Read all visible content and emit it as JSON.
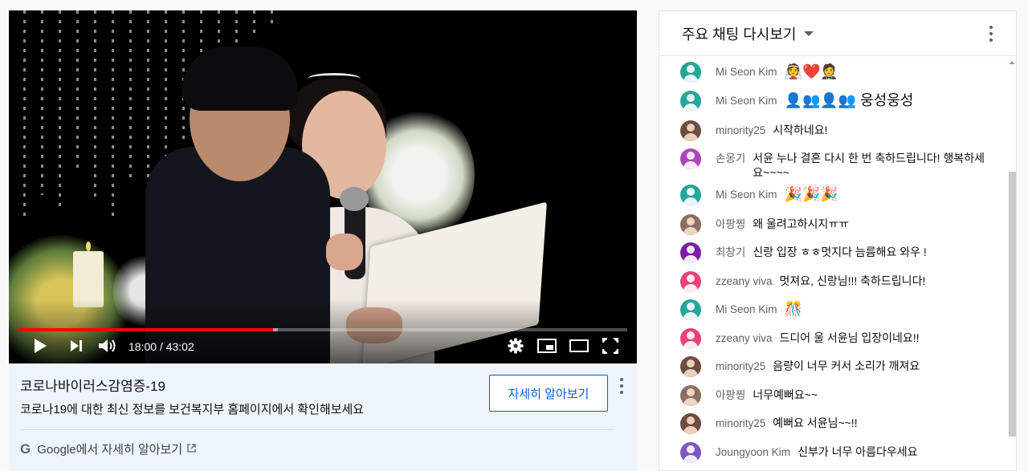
{
  "player": {
    "time_display": "18:00 / 43:02",
    "progress_played": 0.418,
    "progress_buffered": 0.426
  },
  "info": {
    "title": "코로나바이러스감염증-19",
    "description": "코로나19에 대한 최신 정보를 보건복지부 홈페이지에서 확인해보세요",
    "learn_more_label": "자세히 알아보기",
    "google_label": "Google에서 자세히 알아보기",
    "google_icon": "G"
  },
  "chat": {
    "title": "주요 채팅 다시보기",
    "messages": [
      {
        "author": "Mi Seon Kim",
        "text": "👰❤️🤵",
        "avatar_color": "#26a69a",
        "photo": false
      },
      {
        "author": "Mi Seon Kim",
        "text": "👤👥👤👥 웅성웅성",
        "avatar_color": "#26a69a",
        "photo": false
      },
      {
        "author": "minority25",
        "text": "시작하네요!",
        "avatar_color": "#6d4c41",
        "photo": true
      },
      {
        "author": "손옹기",
        "text": "서윤 누나 결혼 다시 한 번 축하드립니다! 행복하세요~~~~",
        "avatar_color": "#ab47bc",
        "photo": false
      },
      {
        "author": "Mi Seon Kim",
        "text": "🎉🎉🎉",
        "avatar_color": "#26a69a",
        "photo": false
      },
      {
        "author": "아팡찡",
        "text": "왜 울려고하시지ㅠㅠ",
        "avatar_color": "#8d6e63",
        "photo": true
      },
      {
        "author": "최창기",
        "text": "신랑 입장 ㅎㅎ멋지다 늠름해요 와우 !",
        "avatar_color": "#7b1fa2",
        "photo": false
      },
      {
        "author": "zzeany viva",
        "text": "멋져요, 신랑님!!! 축하드립니다!",
        "avatar_color": "#ec407a",
        "photo": false
      },
      {
        "author": "Mi Seon Kim",
        "text": "🎊",
        "avatar_color": "#26a69a",
        "photo": false
      },
      {
        "author": "zzeany viva",
        "text": "드디어 울 서윤님 입장이네요!!",
        "avatar_color": "#ec407a",
        "photo": false
      },
      {
        "author": "minority25",
        "text": "음량이 너무 커서 소리가 깨져요",
        "avatar_color": "#6d4c41",
        "photo": true
      },
      {
        "author": "아팡찡",
        "text": "너무예뻐요~~",
        "avatar_color": "#8d6e63",
        "photo": true
      },
      {
        "author": "minority25",
        "text": "예뻐요 서윤님~~!!",
        "avatar_color": "#6d4c41",
        "photo": true
      },
      {
        "author": "Joungyoon Kim",
        "text": "신부가 너무 아름다우세요",
        "avatar_color": "#7e57c2",
        "photo": false
      }
    ]
  },
  "icons": {
    "play": "play-icon",
    "next": "next-icon",
    "volume": "volume-icon",
    "settings": "settings-icon",
    "miniplayer": "miniplayer-icon",
    "theater": "theater-icon",
    "fullscreen": "fullscreen-icon"
  },
  "colors": {
    "progress": "#ff0000",
    "link_blue": "#065fd4",
    "info_bg": "#eef4fb"
  }
}
